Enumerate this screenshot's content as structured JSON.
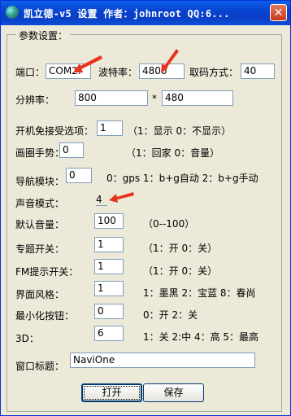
{
  "window": {
    "title": "凯立德-v5 设置  作者：johnroot  QQ:6...",
    "close_symbol": "✕"
  },
  "group_title": "参数设置：",
  "rows": {
    "port": {
      "label": "端口：",
      "value": "COM2:"
    },
    "baud": {
      "label": "波特率：",
      "value": "4800"
    },
    "decode": {
      "label": "取码方式：",
      "value": "40"
    },
    "resolution": {
      "label": "分辨率：",
      "width": "800",
      "sep": "*",
      "height": "480"
    },
    "skip_disclaimer": {
      "label": "开机免接受选项：",
      "value": "1",
      "hint": "（1：显示 0：不显示）"
    },
    "circle_gesture": {
      "label": "画圈手势：",
      "value": "0",
      "hint": "（1：回家 0：音量）"
    },
    "nav_module": {
      "label": "导航模块：",
      "value": "0",
      "hint": "0：gps  1：b+g自动  2：b+g手动"
    },
    "sound_mode": {
      "label": "声音模式：",
      "value": "4"
    },
    "default_volume": {
      "label": "默认音量：",
      "value": "100",
      "hint": "（0--100）"
    },
    "theme_switch": {
      "label": "专题开关：",
      "value": "1",
      "hint": "（1：开 0：关）"
    },
    "fm_prompt": {
      "label": "FM提示开关：",
      "value": "1",
      "hint": "（1：开 0：关）"
    },
    "ui_style": {
      "label": "界面风格：",
      "value": "1",
      "hint": "1：墨黑  2：宝蓝  8：春尚"
    },
    "minimize_button": {
      "label": "最小化按钮：",
      "value": "0",
      "hint": "0：开 2：关"
    },
    "three_d": {
      "label": "3D：",
      "value": "6",
      "hint": "1：关 2:中 4：高 5：最高"
    },
    "window_title": {
      "label": "窗口标题：",
      "value": "NaviOne"
    }
  },
  "buttons": {
    "open": "打开",
    "save": "保存"
  },
  "colors": {
    "arrow": "#e8341f",
    "titlebar": "#0a4fd6"
  }
}
